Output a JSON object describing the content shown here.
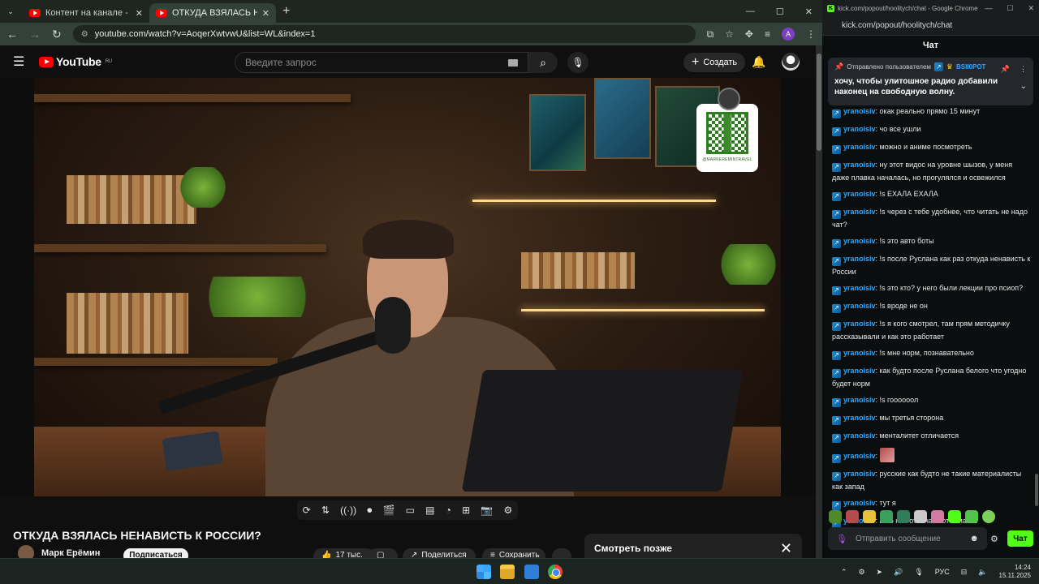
{
  "youtube_window": {
    "tabs": [
      {
        "title": "Контент на канале - YouTube Studio"
      },
      {
        "title": "ОТКУДА ВЗЯЛАСЬ НЕНАВИСТЬ К РОССИИ? - YouTube"
      }
    ],
    "url": "youtube.com/watch?v=AoqerXwtvwU&list=WL&index=1",
    "logo_text": "YouTube",
    "logo_region": "RU",
    "search_placeholder": "Введите запрос",
    "create_label": "Создать",
    "qr_label": "@MARKEREMINTRAVEL",
    "video_title": "ОТКУДА ВЗЯЛАСЬ НЕНАВИСТЬ К РОССИИ?",
    "channel_name": "Марк Ерёмин",
    "subscribe_label": "Подписаться",
    "like_count": "17 тыс.",
    "share_label": "Поделиться",
    "save_label": "Сохранить",
    "watch_later_title": "Смотреть позже",
    "player_controls": [
      "loop-icon",
      "sort-icon",
      "broadcast-icon",
      "record-icon",
      "clapper-icon",
      "crop-icon",
      "subtitles-icon",
      "speed-icon",
      "add-icon",
      "camera-icon",
      "gear-icon"
    ]
  },
  "kick_window": {
    "title": "kick.com/popout/hoolitych/chat - Google Chrome",
    "url": "kick.com/popout/hoolitych/chat",
    "header": "Чат",
    "pinned": {
      "prefix": "Отправлено пользователем",
      "user": "BSII0POT",
      "text": "хочу, чтобы улитошное радио добавили наконец на свободную волну."
    },
    "messages": [
      {
        "user": "yranoisiv",
        "text": "окак реально прямо 15 минут"
      },
      {
        "user": "yranoisiv",
        "text": "чо все ушли"
      },
      {
        "user": "yranoisiv",
        "text": "можно и аниме посмотреть"
      },
      {
        "user": "yranoisiv",
        "text": "ну этот видос на уровне шызов, у меня даже плавка началась, но прогулялся и освежился"
      },
      {
        "user": "yranoisiv",
        "text": "!s ЕХАЛА ЕХАЛА"
      },
      {
        "user": "yranoisiv",
        "text": "!s через с тебе удобнее, что читать не надо чат?"
      },
      {
        "user": "yranoisiv",
        "text": "!s это авто боты"
      },
      {
        "user": "yranoisiv",
        "text": "!s после Руслана как раз откуда ненависть к России"
      },
      {
        "user": "yranoisiv",
        "text": "!s это кто? у него были лекции про псиоп?"
      },
      {
        "user": "yranoisiv",
        "text": "!s вроде не он"
      },
      {
        "user": "yranoisiv",
        "text": "!s я кого смотрел, там прям методичку рассказывали и как это работает"
      },
      {
        "user": "yranoisiv",
        "text": "!s мне норм, познавательно"
      },
      {
        "user": "yranoisiv",
        "text": "как будто после Руслана белого что угодно будет норм"
      },
      {
        "user": "yranoisiv",
        "text": "!s гоооооол"
      },
      {
        "user": "yranoisiv",
        "text": "мы третья сторона"
      },
      {
        "user": "yranoisiv",
        "text": "менталитет отличается"
      },
      {
        "user": "yranoisiv",
        "text": ""
      },
      {
        "user": "yranoisiv",
        "text": "русские как будто не такие материалисты как запад"
      },
      {
        "user": "yranoisiv",
        "text": "тут я"
      },
      {
        "user": "yranoisiv",
        "text": "а чо нас отличает от азиатов"
      }
    ],
    "input_placeholder": "Отправить сообщение",
    "send_label": "Чат"
  },
  "taskbar": {
    "lang": "РУС",
    "time": "14:24",
    "date": "15.11.2025"
  },
  "colors": {
    "kick_green": "#53fc18",
    "chat_user": "#2ea7ff",
    "yt_red": "#ff0000"
  }
}
